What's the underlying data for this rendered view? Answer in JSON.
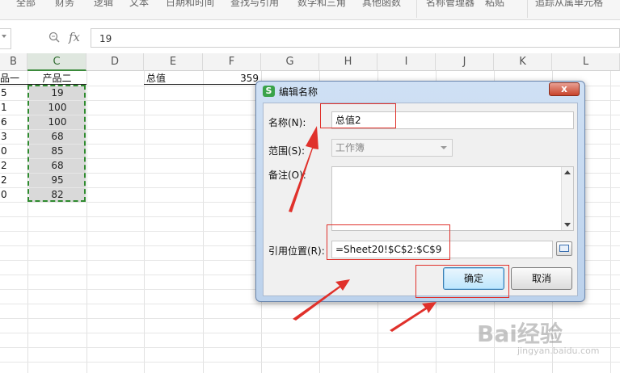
{
  "ribbon": {
    "items": [
      "全部",
      "财务",
      "逻辑",
      "文本",
      "日期和时间",
      "查找与引用",
      "数学和三角",
      "其他函数",
      "名称管理器",
      "粘贴",
      "追踪从属单元格"
    ]
  },
  "formula_bar": {
    "fx_label": "fx",
    "value": "19"
  },
  "sheet": {
    "columns": [
      "B",
      "C",
      "D",
      "E",
      "F",
      "G",
      "H",
      "I",
      "J",
      "K",
      "L"
    ],
    "selected_column": "C",
    "row_labels_partial": [
      "5",
      "1",
      "6",
      "3",
      "0",
      "2",
      "2",
      "0"
    ],
    "b_header": "品一",
    "c_header": "产品二",
    "c_values": [
      "19",
      "100",
      "100",
      "68",
      "85",
      "68",
      "95",
      "82"
    ],
    "e1": "总值",
    "f1": "359"
  },
  "dialog": {
    "app_icon_letter": "S",
    "title": "编辑名称",
    "close_label": "x",
    "name_label": "名称(N):",
    "name_value": "总值2",
    "scope_label": "范围(S):",
    "scope_value": "工作簿",
    "comment_label": "备注(O):",
    "comment_value": "",
    "ref_label": "引用位置(R):",
    "ref_value": "=Sheet20!$C$2:$C$9",
    "ok_label": "确定",
    "cancel_label": "取消"
  },
  "watermark": {
    "brand": "Bai经验",
    "url": "jingyan.baidu.com"
  },
  "colors": {
    "selection_border": "#2f8a2f",
    "highlight_red": "#e0312b",
    "dialog_frame": "#bcd2ec"
  },
  "icons": {
    "zoom": "magnifier-icon",
    "close": "close-icon",
    "range_picker": "range-picker-icon",
    "dropdown": "chevron-down-icon"
  }
}
